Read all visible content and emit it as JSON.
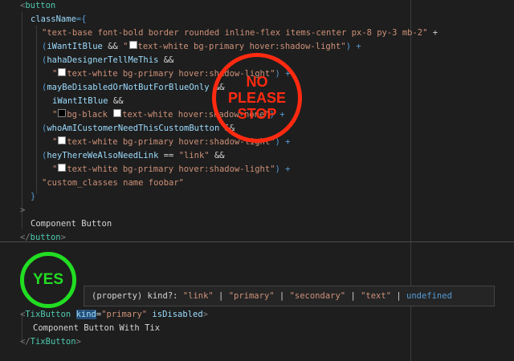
{
  "top_code": {
    "l1_tag": "button",
    "l2_attr": "className",
    "l2_eq": "={",
    "l3_str": "\"text-base font-bold border rounded inline-flex items-center px-8 py-3 mb-2\"",
    "l3_plus": " +",
    "l4_open": "(",
    "l4_var": "iWantItBlue",
    "l4_and": " && ",
    "l4_str_a": "\"",
    "l4_str_b": "text-white bg-primary hover:shadow-light\"",
    "l4_close": ") +",
    "l5_open": "(",
    "l5_var": "hahaDesignerTellMeThis",
    "l5_and": " &&",
    "l6_str_a": "\"",
    "l6_str_b": "text-white bg-primary hover:shadow-light\"",
    "l6_close": ") +",
    "l7_open": "(",
    "l7_var": "mayBeDisabledOrNotButForBlueOnly",
    "l7_and": " &&",
    "l8_var": "iWantItBlue",
    "l8_and": " &&",
    "l9_str_a": "\"",
    "l9_str_b": "bg-black ",
    "l9_str_c": "text-white hover:shadow-none\"",
    "l9_close": ") +",
    "l10_open": "(",
    "l10_var": "whoAmICustomerNeedThisCustomButton",
    "l10_and": " &&",
    "l11_str_a": "\"",
    "l11_str_b": "text-white bg-primary hover:shadow-light\"",
    "l11_close": ") +",
    "l12_open": "(",
    "l12_var": "heyThereWeAlsoNeedLink",
    "l12_eqeq": " == ",
    "l12_str": "\"link\"",
    "l12_and": " &&",
    "l13_str_a": "\"",
    "l13_str_b": "text-white bg-primary hover:shadow-light\"",
    "l13_close": ") +",
    "l14_str": "\"custom_classes name foobar\"",
    "l15_brace": "}",
    "l16_gt": ">",
    "l17_text": "Component Button",
    "l18_tag": "button"
  },
  "stamps": {
    "no_line1": "NO",
    "no_line2": "PLEASE",
    "no_line3": "STOP",
    "yes": "YES"
  },
  "tooltip": {
    "prefix": "(property) kind?: ",
    "v1": "\"link\"",
    "sep": " | ",
    "v2": "\"primary\"",
    "v3": "\"secondary\"",
    "v4": "\"text\"",
    "v5": "undefined"
  },
  "bottom_code": {
    "b1_tag": "TixButton",
    "b1_attr": "kind",
    "b1_eq": "=",
    "b1_val": "\"primary\"",
    "b1_attr2": "isDisabled",
    "b1_gt": ">",
    "b2_text": "Component Button With Tix",
    "b3_tag": "TixButton"
  },
  "colors": {
    "no_stamp": "#ff2a10",
    "yes_stamp": "#22dd22",
    "editor_bg": "#1e1e1e"
  }
}
